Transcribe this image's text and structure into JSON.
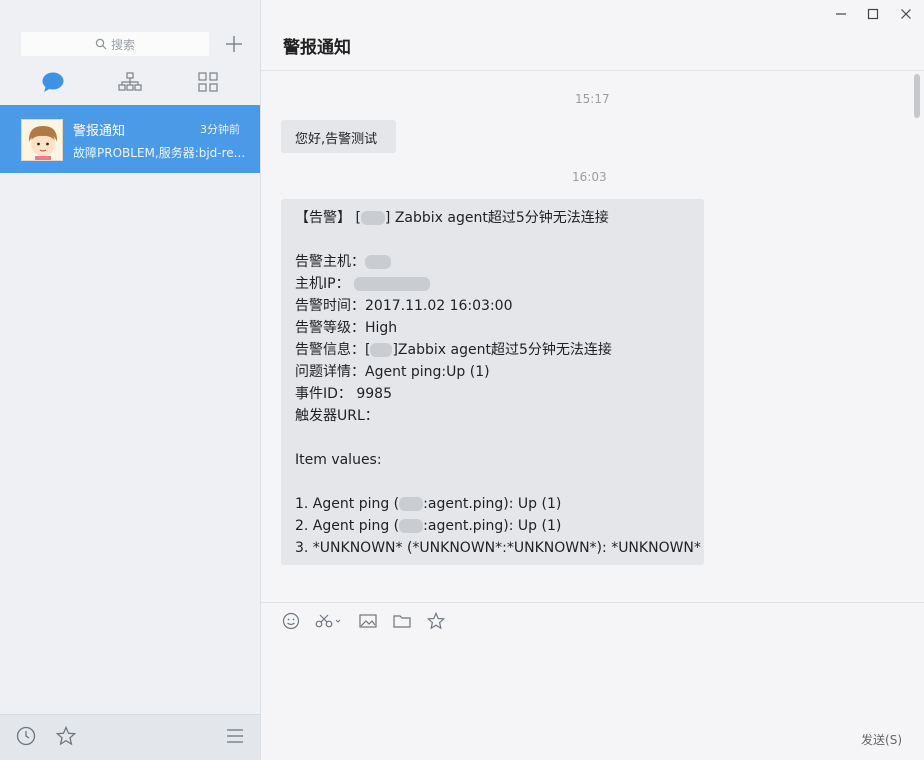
{
  "sidebar": {
    "search_placeholder": "搜索",
    "conversation": {
      "name": "警报通知",
      "time": "3分钟前",
      "preview": "故障PROBLEM,服务器:bjd-re..."
    }
  },
  "main": {
    "title": "警报通知",
    "messages": [
      {
        "timestamp": "15:17",
        "text": "您好,告警测试"
      },
      {
        "timestamp": "16:03",
        "lines": [
          "【告警】",
          "Zabbix agent超过5分钟无法连接",
          "告警主机：",
          "主机IP：",
          "告警时间：2017.11.02  16:03:00",
          "告警等级：High",
          "告警信息：[",
          "]Zabbix agent超过5分钟无法连接",
          "问题详情：Agent ping:Up (1)",
          "事件ID：  9985",
          "触发器URL：",
          "Item values:",
          "1. Agent ping (",
          ":agent.ping): Up (1)",
          "2. Agent ping (",
          ":agent.ping): Up (1)",
          "3. *UNKNOWN* (*UNKNOWN*:*UNKNOWN*): *UNKNOWN*"
        ]
      }
    ],
    "send_label": "发送(S)"
  },
  "colors": {
    "accent": "#4b9ae8",
    "bubble": "#e4e6ea"
  }
}
